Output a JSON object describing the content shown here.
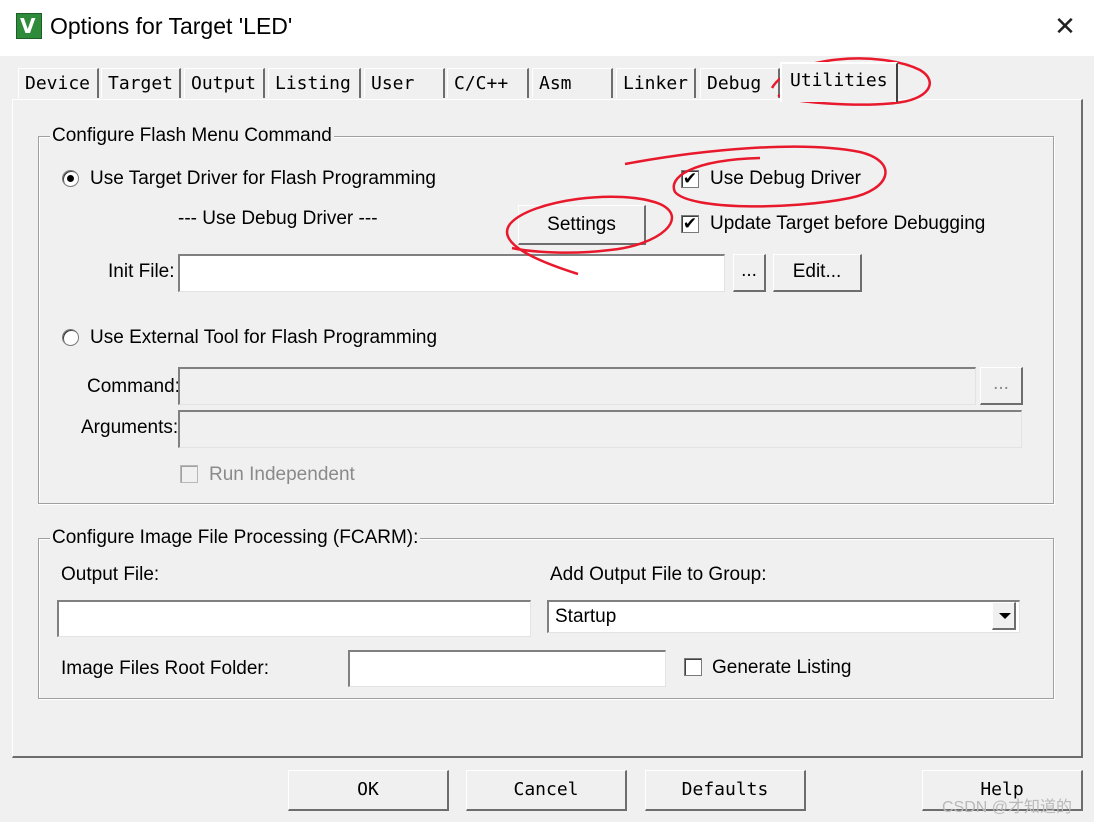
{
  "window": {
    "title": "Options for Target 'LED'",
    "app_icon_glyph": "V",
    "close_glyph": "✕"
  },
  "tabs": [
    {
      "label": "Device",
      "active": false
    },
    {
      "label": "Target",
      "active": false
    },
    {
      "label": "Output",
      "active": false
    },
    {
      "label": "Listing",
      "active": false
    },
    {
      "label": "User",
      "active": false
    },
    {
      "label": "C/C++",
      "active": false
    },
    {
      "label": "Asm",
      "active": false
    },
    {
      "label": "Linker",
      "active": false
    },
    {
      "label": "Debug",
      "active": false
    },
    {
      "label": "Utilities",
      "active": true
    }
  ],
  "flash_group": {
    "title": "Configure Flash Menu Command",
    "use_target_driver": {
      "label": "Use Target Driver for Flash Programming",
      "selected": true
    },
    "driver_name": "--- Use Debug Driver ---",
    "settings_button": "Settings",
    "use_debug_driver": {
      "label": "Use Debug Driver",
      "checked": true
    },
    "update_target": {
      "label": "Update Target before Debugging",
      "checked": true
    },
    "init_file": {
      "label": "Init File:",
      "value": ""
    },
    "browse_button": "...",
    "edit_button": "Edit...",
    "use_external_tool": {
      "label": "Use External Tool for Flash Programming",
      "selected": false
    },
    "command": {
      "label": "Command:",
      "value": ""
    },
    "command_browse": "...",
    "arguments": {
      "label": "Arguments:",
      "value": ""
    },
    "run_independent": {
      "label": "Run Independent",
      "checked": false,
      "enabled": false
    }
  },
  "image_group": {
    "title": "Configure Image File Processing (FCARM):",
    "output_file": {
      "label": "Output File:",
      "value": ""
    },
    "add_to_group": {
      "label": "Add Output File  to Group:",
      "value": "Startup"
    },
    "root_folder": {
      "label": "Image Files Root Folder:",
      "value": ""
    },
    "generate_listing": {
      "label": "Generate Listing",
      "checked": false
    }
  },
  "buttons": {
    "ok": "OK",
    "cancel": "Cancel",
    "defaults": "Defaults",
    "help": "Help"
  },
  "watermark": "CSDN @才知道的",
  "annotation_color": "#e8192c",
  "check_glyph": "✔"
}
